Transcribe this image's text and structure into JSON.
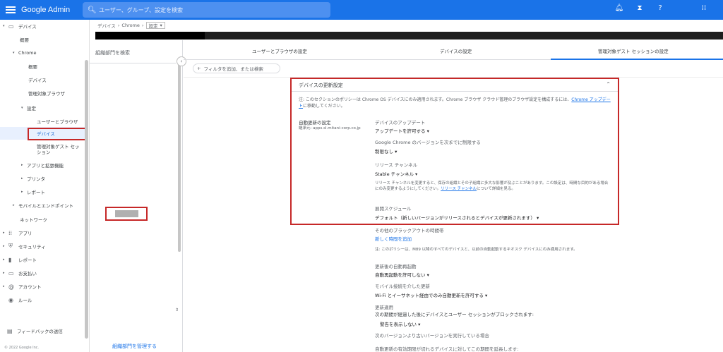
{
  "topbar": {
    "app_name": "Google Admin",
    "search_placeholder": "ユーザー、グループ、設定を検索",
    "bg_color": "#1a73e8"
  },
  "sidebar": {
    "items": [
      {
        "label": "デバイス",
        "arrow": "▾",
        "icon": "devices-icon"
      },
      {
        "label": "概要"
      },
      {
        "label": "Chrome",
        "arrow": "▾"
      },
      {
        "label": "概要"
      },
      {
        "label": "デバイス"
      },
      {
        "label": "管理対象ブラウザ"
      },
      {
        "label": "設定",
        "arrow": "▾"
      },
      {
        "label": "ユーザーとブラウザ"
      },
      {
        "label": "デバイス",
        "selected": true
      },
      {
        "label": "管理対象ゲスト セッション"
      },
      {
        "label": "アプリと拡張機能",
        "arrow": "▸"
      },
      {
        "label": "プリンタ",
        "arrow": "▸"
      },
      {
        "label": "レポート",
        "arrow": "▸"
      },
      {
        "label": "モバイルとエンドポイント",
        "arrow": "▸"
      },
      {
        "label": "ネットワーク"
      },
      {
        "label": "アプリ",
        "arrow": "▸",
        "icon": "apps-grid-icon"
      },
      {
        "label": "セキュリティ",
        "arrow": "▸",
        "icon": "shield-icon"
      },
      {
        "label": "レポート",
        "arrow": "▸",
        "icon": "bar-chart-icon"
      },
      {
        "label": "お支払い",
        "arrow": "▸",
        "icon": "billing-icon"
      },
      {
        "label": "アカウント",
        "arrow": "▸",
        "icon": "at-icon"
      },
      {
        "label": "ルール",
        "icon": "rules-icon"
      }
    ],
    "feedback_label": "フィードバックの送信",
    "copyright": "© 2022 Google Inc."
  },
  "breadcrumb": {
    "items": [
      "デバイス",
      "Chrome"
    ],
    "current": "設定"
  },
  "ou_panel": {
    "search_placeholder": "組織部門を検索",
    "manage_link": "組織部門を管理する"
  },
  "tabs": [
    {
      "label": "ユーザーとブラウザの設定"
    },
    {
      "label": "デバイスの設定",
      "active": true
    },
    {
      "label": "管理対象ゲスト セッションの設定"
    }
  ],
  "filter": {
    "placeholder": "フィルタを追加、または検索"
  },
  "card": {
    "title": "デバイスの更新設定",
    "note": "注: このセクションのポリシーは Chrome OS デバイスにのみ適用されます。Chrome ブラウザ クラウド管理のブラウザ設定を構成するには、",
    "note_link": "Chrome アップデート",
    "note_tail": "に移動してください。",
    "setting_title": "自動更新の設定",
    "applied_from": "継承元: apps.sl.mitani-corp.co.jp",
    "fields": {
      "device_updates_label": "デバイスのアップデート",
      "device_updates_value": "アップデートを許可する",
      "version_limit_label": "Google Chrome のバージョンを次までに制限する",
      "version_limit_value": "制限なし",
      "channel_label": "リリース チャンネル",
      "channel_value": "Stable チャンネル",
      "channel_note": "リリース チャンネルを変更すると、保存の組織とその子組織に多大な影響が及ぶことがあります。この設定は、時間な目的がある場合にのみ変更するようにしてください。",
      "channel_note_link": "リリース チャンネル",
      "channel_note_tail": "について詳細を見る。",
      "schedule_label": "展開スケジュール",
      "schedule_value": "デフォルト（新しいバージョンがリリースされるとデバイスが更新されます）"
    }
  },
  "below": {
    "other_blackout": "その他のブラックアウトの時間帯",
    "add_new": "新しく時間を追加",
    "note2": "注: このポリシーは、M89 以降のすべてのデバイスと、以前の自動起動するキオスク デバイスにのみ適用されます。",
    "auto_reboot_label": "更新後の自動再起動",
    "auto_reboot_value": "自動再起動を許可しない",
    "mobile_label": "モバイル接続を介した更新",
    "mobile_value": "Wi-Fi とイーサネット経由でのみ自動更新を許可する",
    "enforce_label": "更新適用",
    "enforce_desc": "次の期間が経過した後にデバイスとユーザー セッションがブロックされます:",
    "enforce_value": "警告を表示しない",
    "older_label": "次のバージョンより古いバージョンを実行している場合",
    "last_line": "自動更新の有効期限が切れるデバイスに対してこの期間を延長します:"
  }
}
